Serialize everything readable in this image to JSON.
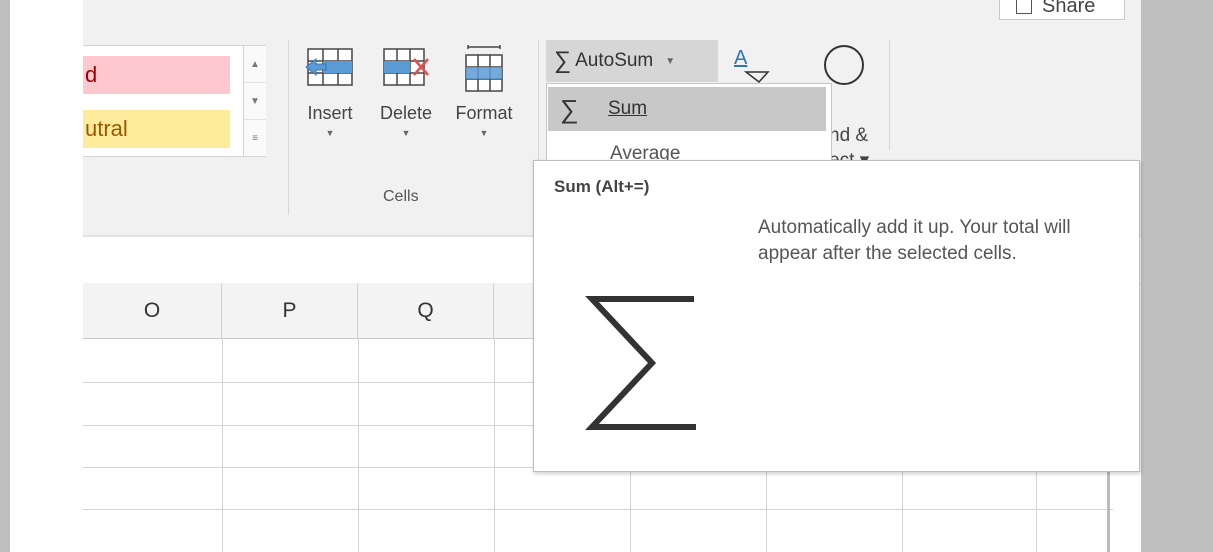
{
  "ribbon": {
    "share_label": "Share",
    "styles": {
      "bad_label": "d",
      "neutral_label": "utral"
    },
    "cells_group": {
      "insert_label": "Insert",
      "delete_label": "Delete",
      "format_label": "Format",
      "group_label": "Cells"
    },
    "editing": {
      "autosum_label": "AutoSum",
      "find_select_line1": "nd &",
      "find_select_line2": "ect ▾"
    }
  },
  "autosum_menu": {
    "items": [
      {
        "label": "Sum",
        "icon": "sigma-icon",
        "selected": true
      },
      {
        "label": "Average"
      }
    ]
  },
  "tooltip": {
    "title": "Sum (Alt+=)",
    "description": "Automatically add it up. Your total will appear after the selected cells.",
    "icon": "sigma-icon"
  },
  "sheet": {
    "column_headers": [
      "O",
      "P",
      "Q"
    ]
  },
  "colors": {
    "bad_fill": "#ffc7ce",
    "neutral_fill": "#ffeb9c",
    "selected_item": "#c8c8c8",
    "ribbon_bg": "#f1f1f1"
  }
}
